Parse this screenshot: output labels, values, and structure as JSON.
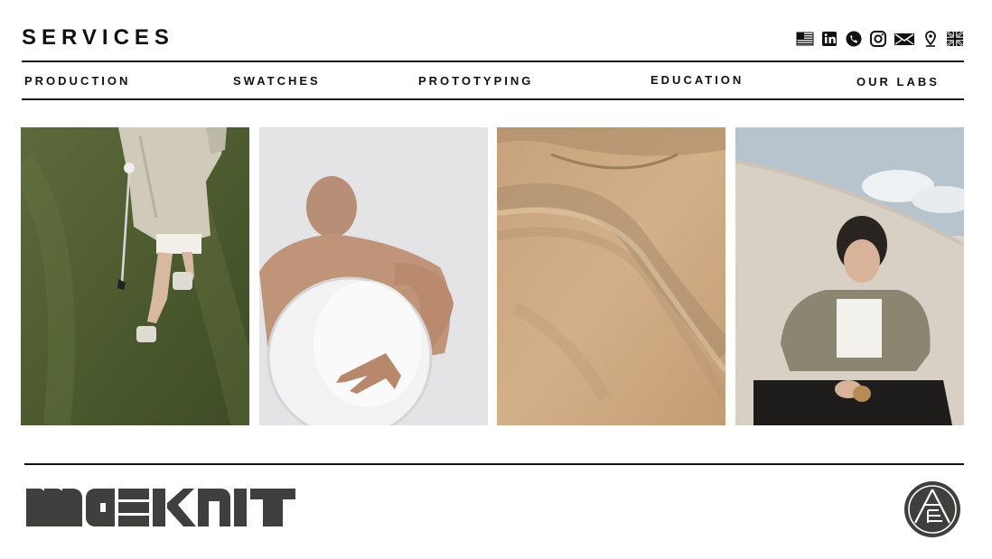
{
  "header": {
    "title": "SERVICES",
    "icons": [
      "us-flag-icon",
      "linkedin-icon",
      "phone-icon",
      "instagram-icon",
      "mail-icon",
      "location-pin-icon",
      "uk-flag-icon"
    ]
  },
  "nav": {
    "items": [
      {
        "label": "PRODUCTION"
      },
      {
        "label": "SWATCHES"
      },
      {
        "label": "PROTOTYPING"
      },
      {
        "label": "EDUCATION"
      },
      {
        "label": "OUR LABS"
      }
    ]
  },
  "gallery": {
    "images": [
      {
        "subject": "person in trench coat walking on grass with golf club"
      },
      {
        "subject": "bald shirtless man holding round mirror behind back"
      },
      {
        "subject": "sandstone rock texture"
      },
      {
        "subject": "young man in jacket sitting on sand dune"
      }
    ]
  },
  "footer": {
    "logo_text": "MAEKNIT",
    "emblem": "circular-emblem-icon"
  },
  "colors": {
    "text": "#111111",
    "rule": "#111111",
    "logo": "#3f3f3d"
  }
}
